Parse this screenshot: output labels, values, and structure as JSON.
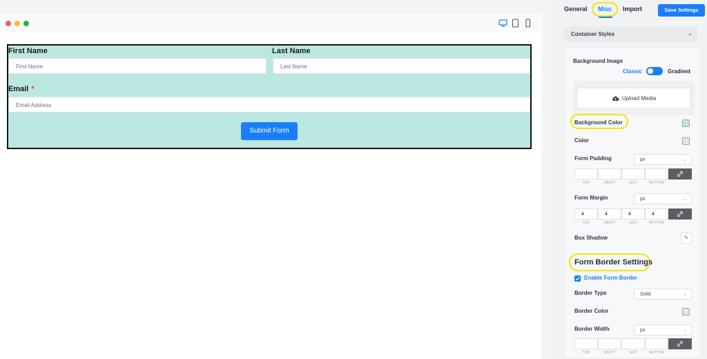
{
  "form": {
    "first_name_label": "First Name",
    "first_name_placeholder": "First Name",
    "last_name_label": "Last Name",
    "last_name_placeholder": "Last Name",
    "email_label": "Email",
    "email_required_mark": "*",
    "email_placeholder": "Email Address",
    "submit_label": "Submit Form",
    "background_color": "#bbe7e1",
    "border_color": "#111111"
  },
  "panel": {
    "tabs": [
      {
        "label": "General"
      },
      {
        "label": "Misc"
      },
      {
        "label": "Import"
      }
    ],
    "save_label": "Save Settings",
    "accordion_title": "Container Styles",
    "background_image_label": "Background Image",
    "toggle_left": "Classic",
    "toggle_right": "Gradient",
    "upload_label": "Upload Media",
    "background_color_label": "Background Color",
    "background_color_value": "#bbe7e1",
    "color_label": "Color",
    "form_padding_label": "Form Padding",
    "form_padding_unit": "px",
    "form_padding_values": [
      "",
      "",
      "",
      ""
    ],
    "side_labels": [
      "TOP",
      "RIGHT",
      "LEFT",
      "BOTTOM"
    ],
    "form_margin_label": "Form Margin",
    "form_margin_unit": "px",
    "form_margin_values": [
      "4",
      "4",
      "4",
      "4"
    ],
    "box_shadow_label": "Box Shadow",
    "border_section_title": "Form Border Settings",
    "enable_border_label": "Enable Form Border",
    "border_type_label": "Border Type",
    "border_type_value": "Solid",
    "border_color_label": "Border Color",
    "border_width_label": "Border Width",
    "border_width_unit": "px",
    "border_width_values": [
      "",
      "",
      "",
      ""
    ],
    "accent_color": "#1a7efb",
    "highlight_color": "#f5e400"
  }
}
